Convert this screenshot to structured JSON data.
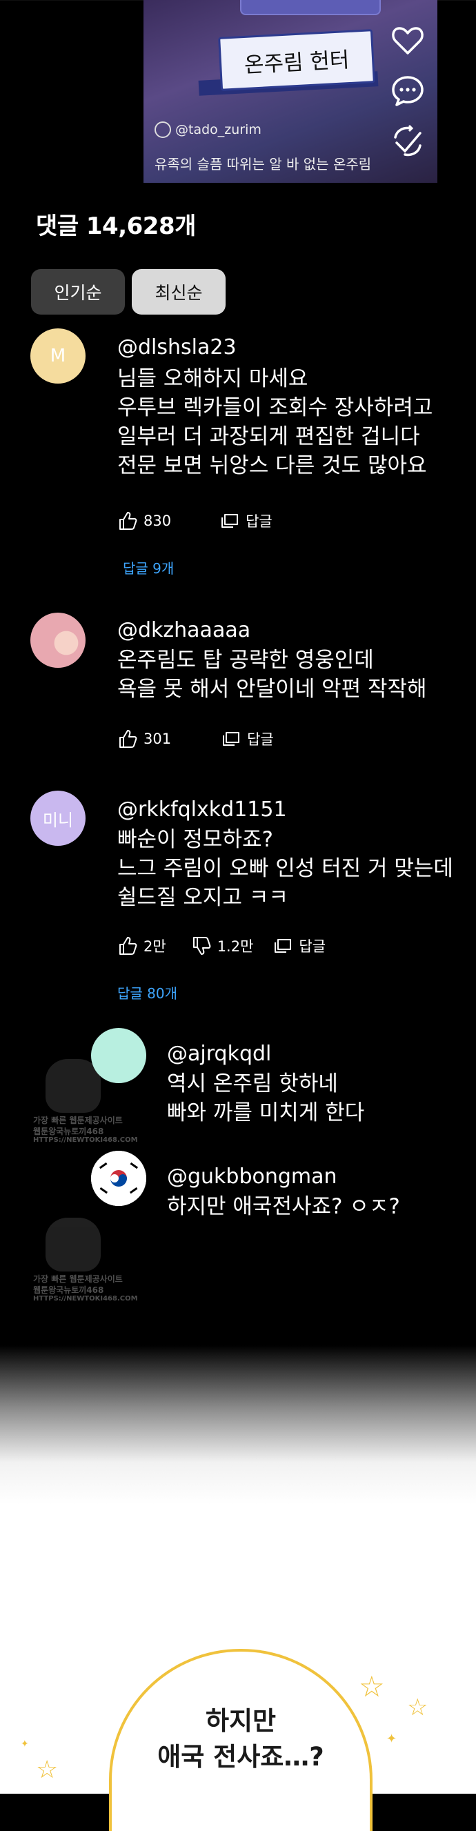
{
  "video": {
    "nameplate": "온주림 헌터",
    "channel": "@tado_zurim",
    "caption": "유족의 슬픔 따위는 알 바 없는 온주림",
    "icons": [
      "heart-icon",
      "comment-icon",
      "share-icon"
    ]
  },
  "comments_section": {
    "title": "댓글 14,628개",
    "sort_popular": "인기순",
    "sort_latest": "최신순"
  },
  "comments": [
    {
      "avatar_text": "M",
      "avatar_color": "#f5dc9e",
      "handle": "@dlshsla23",
      "lines": [
        "님들 오해하지 마세요",
        "우투브 렉카들이 조회수 장사하려고",
        "일부러 더 과장되게 편집한 겁니다",
        "전문 보면 뉘앙스 다른 것도 많아요"
      ],
      "likes": "830",
      "reply_label": "답글",
      "replies": "답글 9개"
    },
    {
      "avatar_text": "",
      "avatar_color": "#e8a8b0",
      "handle": "@dkzhaaaaa",
      "lines": [
        "온주림도 탑 공략한 영웅인데",
        "욕을 못 해서 안달이네 악편 작작해"
      ],
      "likes": "301",
      "reply_label": "답글"
    },
    {
      "avatar_text": "미니",
      "avatar_color": "#c9b8ef",
      "handle": "@rkkfqlxkd1151",
      "lines": [
        "빠순이 정모하죠?",
        "느그 주림이 오빠 인성 터진 거 맞는데",
        "쉴드질 오지고 ㅋㅋ"
      ],
      "likes": "2만",
      "dislikes": "1.2만",
      "reply_label": "답글",
      "replies": "답글 80개"
    }
  ],
  "sub_replies": [
    {
      "avatar_color": "#b8efe0",
      "handle": "@ajrqkqdl",
      "lines": [
        "역시 온주림 핫하네",
        "빠와 까를 미치게 한다"
      ]
    },
    {
      "avatar_color": "#ffffff",
      "handle": "@gukbbongman",
      "lines": [
        "하지만 애국전사죠? ㅇㅈ?"
      ]
    }
  ],
  "watermark_lines": [
    "가장 빠른 웹툰제공사이트",
    "웹툰왕국뉴토끼468",
    "HTTPS://NEWTOKI468.COM"
  ],
  "speech_bubble": {
    "line1": "하지만",
    "line2": "애국 전사죠…?"
  },
  "colors": {
    "background": "#000000",
    "link_blue": "#3ea6ff",
    "bubble_border": "#f0c23c"
  }
}
